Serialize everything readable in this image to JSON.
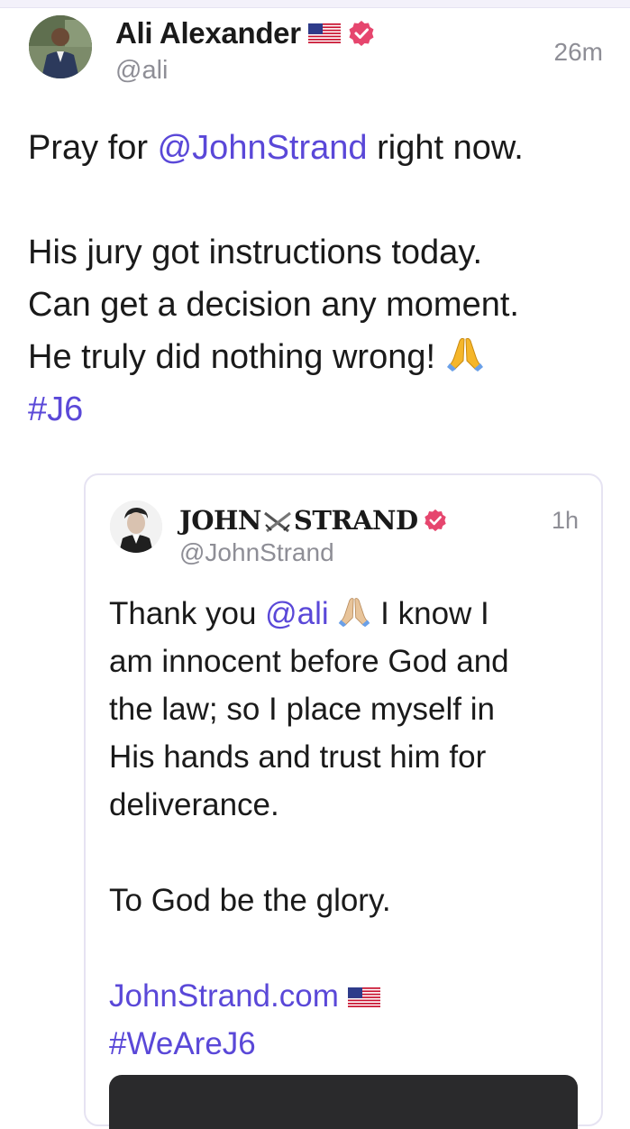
{
  "post": {
    "author": {
      "display_name": "Ali Alexander",
      "handle": "@ali",
      "flag_icon": "us-flag-icon",
      "verified_icon": "verified-badge-icon"
    },
    "timestamp": "26m",
    "text": {
      "line1_pre": "Pray for ",
      "line1_mention": "@JohnStrand",
      "line1_post": " right now.",
      "line2": "His jury got instructions today.",
      "line3": "Can get a decision any moment.",
      "line4": "He truly did nothing wrong! ",
      "hashtag": "#J6"
    },
    "quoted": {
      "author": {
        "display_name_part1": "JOHN",
        "display_name_part2": "STRAND",
        "handle": "@JohnStrand",
        "swords_icon": "crossed-swords-icon",
        "verified_icon": "verified-badge-icon"
      },
      "timestamp": "1h",
      "text": {
        "line1_pre": "Thank you ",
        "line1_mention": "@ali",
        "line1_post": " I know I",
        "line2": "am innocent before God and",
        "line3": "the law; so I place myself in",
        "line4": "His hands and trust him for",
        "line5": "deliverance.",
        "line6": "To God be the glory.",
        "link": "JohnStrand.com",
        "hashtag": "#WeAreJ6"
      }
    }
  },
  "colors": {
    "link": "#5a48d8",
    "muted": "#8e8e96",
    "verified": "#e6466e",
    "card_border": "#e6e3f2"
  }
}
